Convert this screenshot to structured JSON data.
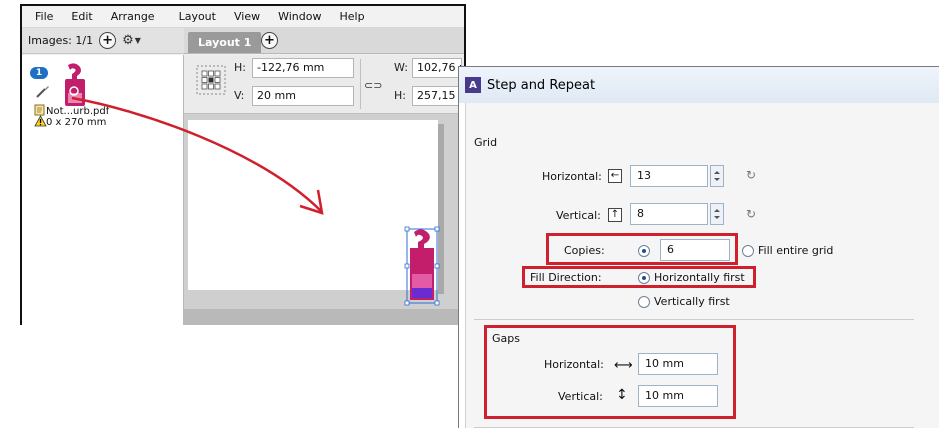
{
  "app": {
    "menu": [
      "File",
      "Edit",
      "Arrange",
      "Layout",
      "View",
      "Window",
      "Help"
    ],
    "images_label": "Images: 1/1",
    "thumbnail_badge": "1",
    "file_name": "Not...urb.pdf",
    "file_size": "0 x 270 mm",
    "tab_label": "Layout 1",
    "props": {
      "h_label": "H:",
      "h_value": "-122,76 mm",
      "v_label": "V:",
      "v_value": "20 mm",
      "w_label": "W:",
      "w_value": "102,76 r",
      "h2_label": "H:",
      "h2_value": "257,15 r"
    }
  },
  "dialog": {
    "title": "Step and Repeat",
    "grid_label": "Grid",
    "horizontal_label": "Horizontal:",
    "horizontal_value": "13",
    "vertical_label": "Vertical:",
    "vertical_value": "8",
    "copies_label": "Copies:",
    "copies_value": "6",
    "fill_entire_grid": "Fill entire grid",
    "fill_direction_label": "Fill Direction:",
    "horizontally_first": "Horizontally first",
    "vertically_first": "Vertically first",
    "gaps_label": "Gaps",
    "gap_horizontal_label": "Horizontal:",
    "gap_horizontal_value": "10 mm",
    "gap_vertical_label": "Vertical:",
    "gap_vertical_value": "10 mm"
  },
  "colors": {
    "annotation_red": "#d0202e",
    "badge_blue": "#1f6fc5",
    "product_magenta": "#c21e6b"
  },
  "icons": [
    "plus-icon",
    "gear-icon",
    "brush-icon",
    "document-icon",
    "warning-icon",
    "anchor-grid-icon",
    "link-icon",
    "reset-icon",
    "arrow-left-icon",
    "arrow-up-icon",
    "double-arrow-horizontal-icon",
    "double-arrow-vertical-icon",
    "step-and-repeat-app-icon"
  ]
}
